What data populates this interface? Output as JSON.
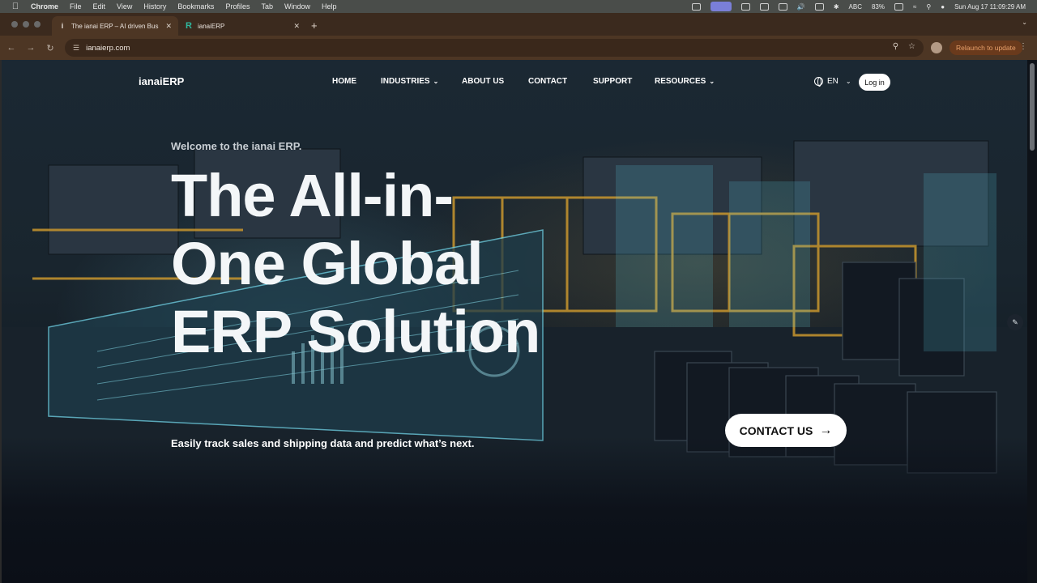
{
  "menubar": {
    "app_name": "Chrome",
    "menus": [
      "File",
      "Edit",
      "View",
      "History",
      "Bookmarks",
      "Profiles",
      "Tab",
      "Window",
      "Help"
    ],
    "input_source": "ABC",
    "battery": "83%",
    "datetime": "Sun Aug 17  11:09:29 AM"
  },
  "browser": {
    "tabs": [
      {
        "title": "The ianai ERP – AI driven Bus",
        "active": true
      },
      {
        "title": "ianaiERP",
        "active": false
      }
    ],
    "url": "ianaierp.com",
    "relaunch_label": "Relaunch to update"
  },
  "site": {
    "logo": "ianaiERP",
    "nav": {
      "home": "HOME",
      "industries": "INDUSTRIES",
      "about": "ABOUT US",
      "contact": "CONTACT",
      "support": "SUPPORT",
      "resources": "RESOURCES"
    },
    "language": "EN",
    "login_label": "Log in"
  },
  "hero": {
    "welcome": "Welcome to the ianai ERP.",
    "title_lines": [
      "The All-in-",
      "One Global",
      "ERP Solution"
    ],
    "tagline": "Easily track sales and shipping data and predict what’s next.",
    "cta_label": "CONTACT US"
  },
  "colors": {
    "tab_strip": "#3b2a1e",
    "toolbar": "#4d3624",
    "relaunch_text": "#e8a06a",
    "hero_dark": "#0b0f17"
  }
}
